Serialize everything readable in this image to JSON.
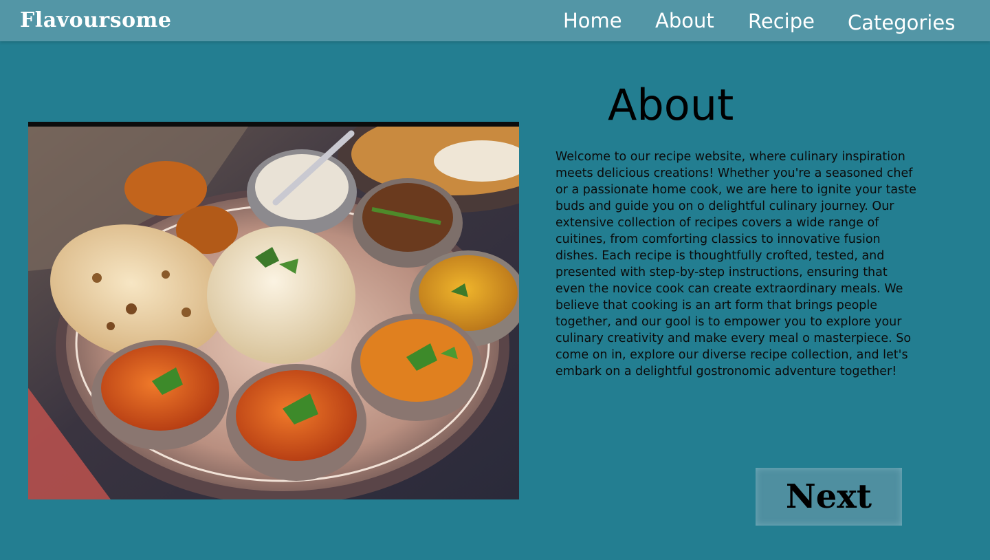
{
  "brand": {
    "name": "Flavoursome"
  },
  "nav": {
    "items": [
      {
        "label": "Home"
      },
      {
        "label": "About"
      },
      {
        "label": "Recipe"
      },
      {
        "label": "Categories"
      }
    ]
  },
  "about": {
    "title": "About",
    "body": "Welcome to our recipe website, where culinary inspiration meets delicious creations! Whether you're a seasoned chef or a passionate home cook, we are here to ignite your taste buds and guide you on o delightful culinary journey. Our extensive collection of recipes covers a wide range of cuitines, from comforting classics to innovative fusion dishes. Each recipe is thoughtfully crofted, tested, and presented with step-by-step instructions, ensuring that even the novice cook can create extraordinary meals. We believe that cooking is an art form that brings people together, and our gool is to empower you to explore your culinary creativity and make every meal o masterpiece. So come on in, explore our diverse recipe collection, and let's embark on a delightful gostronomic adventure together!"
  },
  "next_button": {
    "label": "Next"
  },
  "colors": {
    "page_background": "#237e91",
    "navbar_background": "#5396a6",
    "button_background": "#4f8fa0"
  }
}
